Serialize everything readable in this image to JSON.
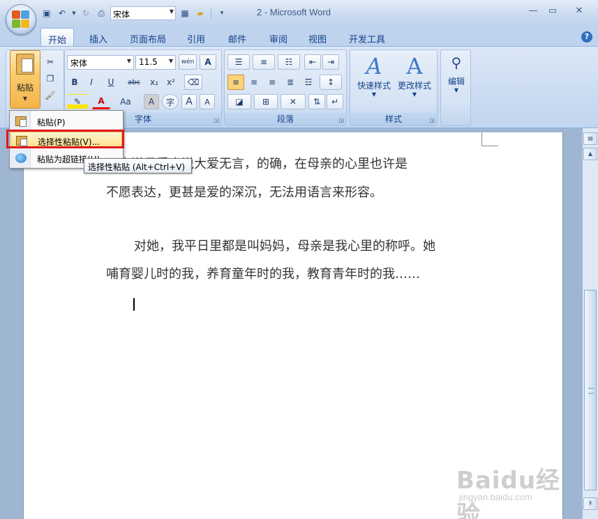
{
  "window": {
    "title": "2 - Microsoft Word",
    "qat_font": "宋体",
    "minimize_label": "—",
    "restore_label": "▭",
    "close_label": "✕"
  },
  "tabs": [
    {
      "label": "开始",
      "active": true
    },
    {
      "label": "插入"
    },
    {
      "label": "页面布局"
    },
    {
      "label": "引用"
    },
    {
      "label": "邮件"
    },
    {
      "label": "审阅"
    },
    {
      "label": "视图"
    },
    {
      "label": "开发工具"
    }
  ],
  "ribbon": {
    "clipboard": {
      "paste_label": "粘贴"
    },
    "font": {
      "group_label": "字体",
      "font_name": "宋体",
      "font_size": "11.5",
      "bold": "B",
      "italic": "I",
      "underline": "U",
      "strike": "abc",
      "subscript": "x₂",
      "superscript": "x²",
      "font_color": "A",
      "case": "Aa",
      "char_shading": "A",
      "enclose": "字",
      "grow": "A",
      "shrink": "A",
      "phonetic": "wén",
      "char_border": "A"
    },
    "paragraph": {
      "group_label": "段落"
    },
    "styles": {
      "group_label": "样式",
      "quick_styles": "快速样式",
      "change_styles": "更改样式"
    },
    "editing": {
      "label": "编辑"
    }
  },
  "paste_menu": {
    "items": [
      {
        "label": "粘贴(P)"
      },
      {
        "label": "选择性粘贴(V)..."
      },
      {
        "label": "粘贴为超链接(H)"
      }
    ],
    "tooltip": "选择性粘贴 (Alt+Ctrl+V)"
  },
  "document": {
    "paragraphs": [
      "有人说母爱会说大爱无言，的确，在母亲的心里也许是",
      "不愿表达，更甚是爱的深沉，无法用语言来形容。",
      "对她，我平日里都是叫妈妈，母亲是我心里的称呼。她",
      "哺育婴儿时的我，养育童年时的我，教育青年时的我……"
    ]
  },
  "watermark": {
    "main": "Baidu经验",
    "sub": "jingyan.baidu.com"
  },
  "colors": {
    "accent": "#15428b",
    "highlight_border": "#e0191d",
    "ribbon": "#c7d9f0"
  }
}
